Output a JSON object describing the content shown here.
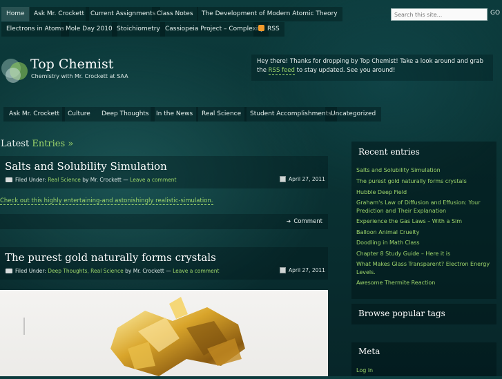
{
  "top_nav": {
    "row1": [
      "Home",
      "Ask Mr. Crockett",
      "Current Assignments",
      "Class Notes",
      "The Development of Modern Atomic Theory"
    ],
    "row2": [
      "Electrons in Atoms",
      "Mole Day 2010",
      "Stoichiometry",
      "Cassiopeia Project – Complexity",
      "RSS"
    ]
  },
  "search": {
    "placeholder": "Search this site...",
    "button": "GO"
  },
  "site": {
    "title": "Top Chemist",
    "tagline": "Chemistry with Mr. Crockett at SAA"
  },
  "welcome": {
    "text_before": "Hey there! Thanks for dropping by Top Chemist! Take a look around and grab the ",
    "rss_link": "RSS feed",
    "text_after": " to stay updated. See you around!"
  },
  "categories": [
    "Ask Mr. Crockett",
    "Culture",
    "Deep Thoughts",
    "In the News",
    "Real Science",
    "Student Accomplishments",
    "Uncategorized"
  ],
  "latest_heading": {
    "prefix": "Latest",
    "word": "Entries",
    "suffix": "»"
  },
  "posts": [
    {
      "title": "Salts and Solubility Simulation",
      "filed_label": "Filed Under:",
      "categories": "Real Science",
      "by": "by Mr. Crockett —",
      "comment_link": "Leave a comment",
      "date": "April 27, 2011",
      "body_link": "Check out this highly entertaining-and astonishingly realistic-simulation.",
      "comment_button": "Comment"
    },
    {
      "title": "The purest gold naturally forms crystals",
      "filed_label": "Filed Under:",
      "categories": "Deep Thoughts, Real Science",
      "by": "by Mr. Crockett —",
      "comment_link": "Leave a comment",
      "date": "April 27, 2011"
    }
  ],
  "sidebar": {
    "recent_title": "Recent entries",
    "recent_entries": [
      "Salts and Solubility Simulation",
      "The purest gold naturally forms crystals",
      "Hubble Deep Field",
      "Graham's Law of Diffusion and Effusion: Your Prediction and Their Explanation",
      "Experience the Gas Laws – With a Sim",
      "Balloon Animal Cruelty",
      "Doodling in Math Class",
      "Chapter 8 Study Guide – Here it is",
      "What Makes Glass Transparent? Electron Energy Levels.",
      "Awesome Thermite Reaction"
    ],
    "tags_title": "Browse popular tags",
    "meta_title": "Meta",
    "meta_login": "Log in"
  }
}
